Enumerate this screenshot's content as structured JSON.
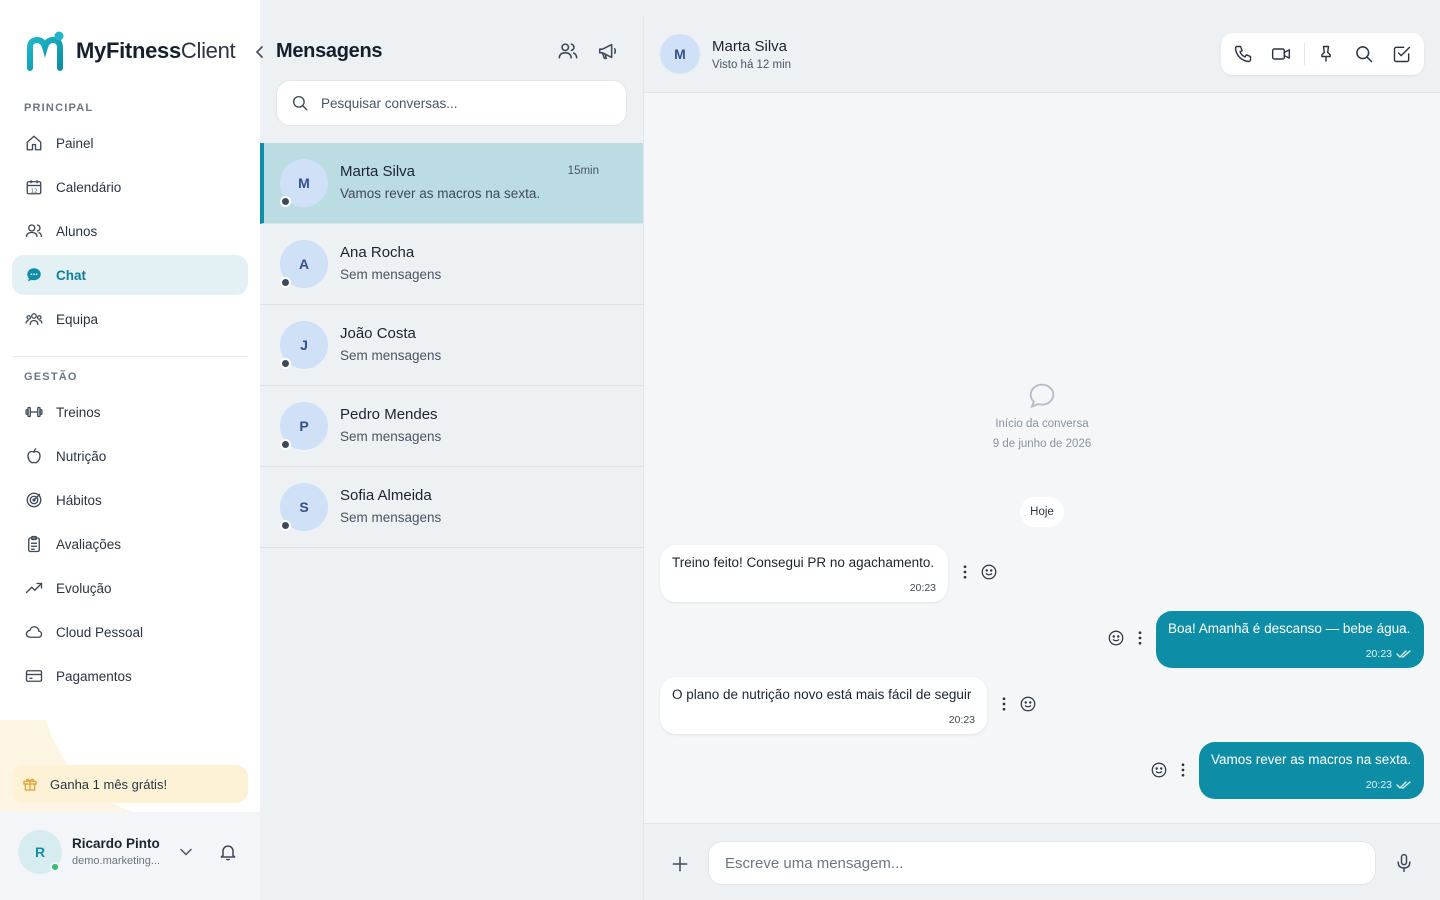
{
  "app": {
    "name_bold": "MyFitness",
    "name_light": "Client"
  },
  "sidebar": {
    "section_principal": "PRINCIPAL",
    "section_gestao": "GESTÃO",
    "principal_items": [
      {
        "label": "Painel",
        "icon": "home-icon"
      },
      {
        "label": "Calendário",
        "icon": "calendar-icon"
      },
      {
        "label": "Alunos",
        "icon": "users-icon"
      },
      {
        "label": "Chat",
        "icon": "chat-icon",
        "active": true
      },
      {
        "label": "Equipa",
        "icon": "team-icon"
      }
    ],
    "gestao_items": [
      {
        "label": "Treinos",
        "icon": "dumbbell-icon"
      },
      {
        "label": "Nutrição",
        "icon": "apple-icon"
      },
      {
        "label": "Hábitos",
        "icon": "target-icon"
      },
      {
        "label": "Avaliações",
        "icon": "clipboard-icon"
      },
      {
        "label": "Evolução",
        "icon": "trend-icon"
      },
      {
        "label": "Cloud Pessoal",
        "icon": "cloud-icon"
      },
      {
        "label": "Pagamentos",
        "icon": "card-icon"
      }
    ],
    "promo": "Ganha 1 mês grátis!",
    "user": {
      "initial": "R",
      "name": "Ricardo Pinto",
      "email": "demo.marketing..."
    }
  },
  "conversations": {
    "title": "Mensagens",
    "search_placeholder": "Pesquisar conversas...",
    "items": [
      {
        "initial": "M",
        "name": "Marta Silva",
        "preview": "Vamos rever as macros na sexta.",
        "time": "15min",
        "active": true
      },
      {
        "initial": "A",
        "name": "Ana Rocha",
        "preview": "Sem mensagens",
        "time": ""
      },
      {
        "initial": "J",
        "name": "João Costa",
        "preview": "Sem mensagens",
        "time": ""
      },
      {
        "initial": "P",
        "name": "Pedro Mendes",
        "preview": "Sem mensagens",
        "time": ""
      },
      {
        "initial": "S",
        "name": "Sofia Almeida",
        "preview": "Sem mensagens",
        "time": ""
      }
    ]
  },
  "chat": {
    "contact": {
      "initial": "M",
      "name": "Marta Silva",
      "status": "Visto há 12 min"
    },
    "start_label": "Início da conversa",
    "start_date": "9 de junho de 2026",
    "day_label": "Hoje",
    "messages": [
      {
        "direction": "in",
        "text": "Treino feito! Consegui PR no agachamento.",
        "time": "20:23"
      },
      {
        "direction": "out",
        "text": "Boa! Amanhã é descanso — bebe água.",
        "time": "20:23"
      },
      {
        "direction": "in",
        "text": "O plano de nutrição novo está mais fácil de seguir",
        "time": "20:23"
      },
      {
        "direction": "out",
        "text": "Vamos rever as macros na sexta.",
        "time": "20:23"
      }
    ],
    "composer_placeholder": "Escreve uma mensagem..."
  },
  "colors": {
    "accent": "#0e8ea6",
    "active_row": "#bcdce4",
    "promo_bg": "#fdf1d6"
  }
}
